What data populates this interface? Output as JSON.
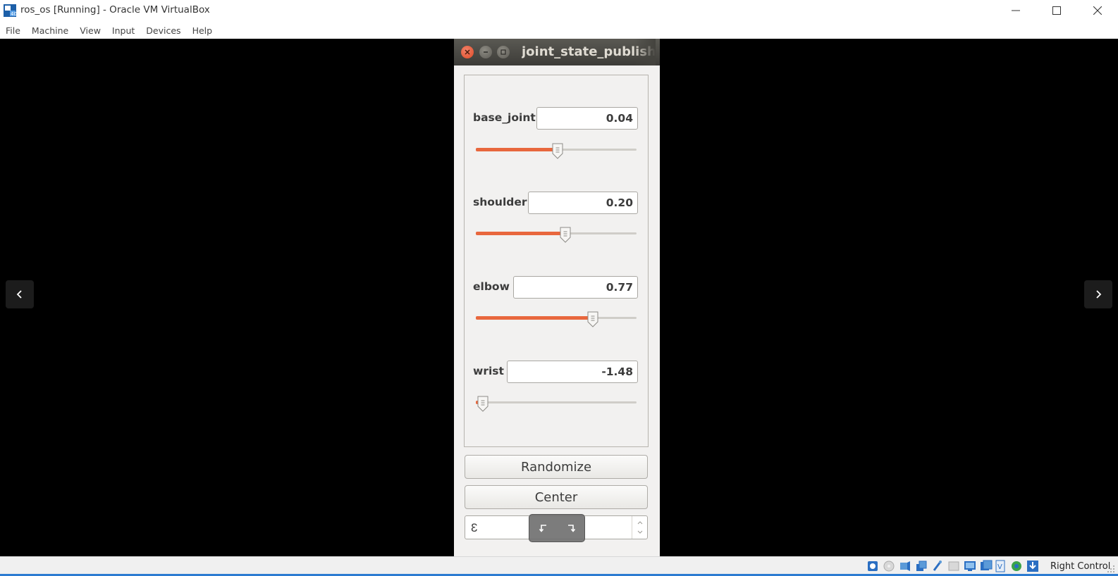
{
  "window": {
    "title": "ros_os [Running] - Oracle VM VirtualBox"
  },
  "menu": {
    "items": [
      "File",
      "Machine",
      "View",
      "Input",
      "Devices",
      "Help"
    ]
  },
  "guest_window": {
    "title": "joint_state_publish"
  },
  "joints": [
    {
      "name": "base_joint",
      "value": "0.04",
      "slider_fraction": 0.51
    },
    {
      "name": "shoulder",
      "value": "0.20",
      "slider_fraction": 0.555
    },
    {
      "name": "elbow",
      "value": "0.77",
      "slider_fraction": 0.73
    },
    {
      "name": "wrist",
      "value": "-1.48",
      "slider_fraction": 0.045
    }
  ],
  "buttons": {
    "randomize": "Randomize",
    "center": "Center"
  },
  "spin": {
    "value": "3"
  },
  "statusbar": {
    "host_key": "Right Control"
  },
  "colors": {
    "slider_fill": "#e8673d",
    "close_button": "#df4a25",
    "statusbar_accent": "#2c7bd1"
  }
}
